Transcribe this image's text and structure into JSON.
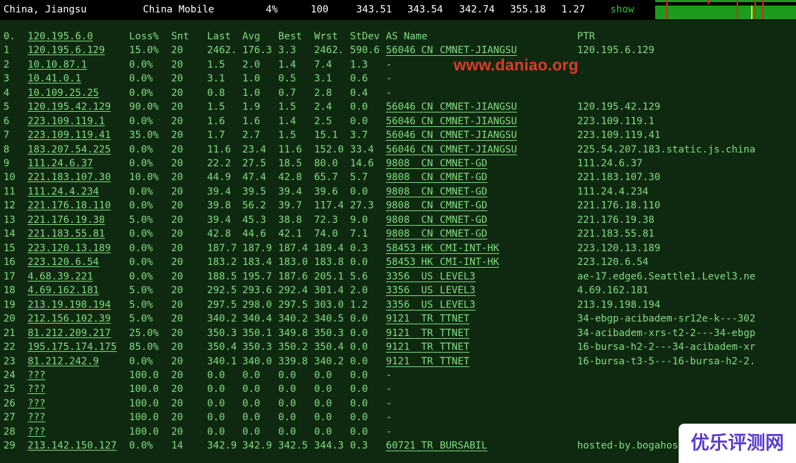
{
  "summary": {
    "location": "China, Jiangsu",
    "isp": "China Mobile",
    "loss": "4%",
    "sent": "100",
    "last": "343.51",
    "avg": "343.54",
    "best": "342.74",
    "worst": "355.18",
    "stdev": "1.27",
    "show_label": "show"
  },
  "header": {
    "hop": "0.",
    "host": "120.195.6.0",
    "loss": "Loss%",
    "sent": "Snt",
    "last": "Last",
    "avg": "Avg",
    "best": "Best",
    "worst": "Wrst",
    "stdev": "StDev",
    "as_name": "AS Name",
    "ptr": "PTR"
  },
  "hops": [
    {
      "hop": "1",
      "host": "120.195.6.129",
      "loss": "15.0%",
      "sent": "20",
      "last": "2462.",
      "avg": "176.3",
      "best": "3.3",
      "worst": "2462.",
      "stdev": "590.6",
      "asn": "56046",
      "cc": "CN",
      "as_name": "CMNET-JIANGSU",
      "ptr": "120.195.6.129"
    },
    {
      "hop": "2",
      "host": "10.10.87.1",
      "loss": "0.0%",
      "sent": "20",
      "last": "1.5",
      "avg": "2.0",
      "best": "1.4",
      "worst": "7.4",
      "stdev": "1.3",
      "asn": "-",
      "cc": "",
      "as_name": "",
      "ptr": ""
    },
    {
      "hop": "3",
      "host": "10.41.0.1",
      "loss": "0.0%",
      "sent": "20",
      "last": "3.1",
      "avg": "1.0",
      "best": "0.5",
      "worst": "3.1",
      "stdev": "0.6",
      "asn": "-",
      "cc": "",
      "as_name": "",
      "ptr": ""
    },
    {
      "hop": "4",
      "host": "10.109.25.25",
      "loss": "0.0%",
      "sent": "20",
      "last": "0.8",
      "avg": "1.0",
      "best": "0.7",
      "worst": "2.8",
      "stdev": "0.4",
      "asn": "-",
      "cc": "",
      "as_name": "",
      "ptr": ""
    },
    {
      "hop": "5",
      "host": "120.195.42.129",
      "loss": "90.0%",
      "sent": "20",
      "last": "1.5",
      "avg": "1.9",
      "best": "1.5",
      "worst": "2.4",
      "stdev": "0.0",
      "asn": "56046",
      "cc": "CN",
      "as_name": "CMNET-JIANGSU",
      "ptr": "120.195.42.129"
    },
    {
      "hop": "6",
      "host": "223.109.119.1",
      "loss": "0.0%",
      "sent": "20",
      "last": "1.6",
      "avg": "1.6",
      "best": "1.4",
      "worst": "2.5",
      "stdev": "0.0",
      "asn": "56046",
      "cc": "CN",
      "as_name": "CMNET-JIANGSU",
      "ptr": "223.109.119.1"
    },
    {
      "hop": "7",
      "host": "223.109.119.41",
      "loss": "35.0%",
      "sent": "20",
      "last": "1.7",
      "avg": "2.7",
      "best": "1.5",
      "worst": "15.1",
      "stdev": "3.7",
      "asn": "56046",
      "cc": "CN",
      "as_name": "CMNET-JIANGSU",
      "ptr": "223.109.119.41"
    },
    {
      "hop": "8",
      "host": "183.207.54.225",
      "loss": "0.0%",
      "sent": "20",
      "last": "11.6",
      "avg": "23.4",
      "best": "11.6",
      "worst": "152.0",
      "stdev": "33.4",
      "asn": "56046",
      "cc": "CN",
      "as_name": "CMNET-JIANGSU",
      "ptr": "225.54.207.183.static.js.china"
    },
    {
      "hop": "9",
      "host": "111.24.6.37",
      "loss": "0.0%",
      "sent": "20",
      "last": "22.2",
      "avg": "27.5",
      "best": "18.5",
      "worst": "80.0",
      "stdev": "14.6",
      "asn": "9808",
      "cc": "CN",
      "as_name": "CMNET-GD",
      "ptr": "111.24.6.37"
    },
    {
      "hop": "10",
      "host": "221.183.107.30",
      "loss": "10.0%",
      "sent": "20",
      "last": "44.9",
      "avg": "47.4",
      "best": "42.8",
      "worst": "65.7",
      "stdev": "5.7",
      "asn": "9808",
      "cc": "CN",
      "as_name": "CMNET-GD",
      "ptr": "221.183.107.30"
    },
    {
      "hop": "11",
      "host": "111.24.4.234",
      "loss": "0.0%",
      "sent": "20",
      "last": "39.4",
      "avg": "39.5",
      "best": "39.4",
      "worst": "39.6",
      "stdev": "0.0",
      "asn": "9808",
      "cc": "CN",
      "as_name": "CMNET-GD",
      "ptr": "111.24.4.234"
    },
    {
      "hop": "12",
      "host": "221.176.18.110",
      "loss": "0.0%",
      "sent": "20",
      "last": "39.8",
      "avg": "56.2",
      "best": "39.7",
      "worst": "117.4",
      "stdev": "27.3",
      "asn": "9808",
      "cc": "CN",
      "as_name": "CMNET-GD",
      "ptr": "221.176.18.110"
    },
    {
      "hop": "13",
      "host": "221.176.19.38",
      "loss": "5.0%",
      "sent": "20",
      "last": "39.4",
      "avg": "45.3",
      "best": "38.8",
      "worst": "72.3",
      "stdev": "9.0",
      "asn": "9808",
      "cc": "CN",
      "as_name": "CMNET-GD",
      "ptr": "221.176.19.38"
    },
    {
      "hop": "14",
      "host": "221.183.55.81",
      "loss": "0.0%",
      "sent": "20",
      "last": "42.8",
      "avg": "44.6",
      "best": "42.1",
      "worst": "74.0",
      "stdev": "7.1",
      "asn": "9808",
      "cc": "CN",
      "as_name": "CMNET-GD",
      "ptr": "221.183.55.81"
    },
    {
      "hop": "15",
      "host": "223.120.13.189",
      "loss": "0.0%",
      "sent": "20",
      "last": "187.7",
      "avg": "187.9",
      "best": "187.4",
      "worst": "189.4",
      "stdev": "0.3",
      "asn": "58453",
      "cc": "HK",
      "as_name": "CMI-INT-HK",
      "ptr": "223.120.13.189"
    },
    {
      "hop": "16",
      "host": "223.120.6.54",
      "loss": "0.0%",
      "sent": "20",
      "last": "183.2",
      "avg": "183.4",
      "best": "183.0",
      "worst": "183.8",
      "stdev": "0.0",
      "asn": "58453",
      "cc": "HK",
      "as_name": "CMI-INT-HK",
      "ptr": "223.120.6.54"
    },
    {
      "hop": "17",
      "host": "4.68.39.221",
      "loss": "0.0%",
      "sent": "20",
      "last": "188.5",
      "avg": "195.7",
      "best": "187.6",
      "worst": "205.1",
      "stdev": "5.6",
      "asn": "3356",
      "cc": "US",
      "as_name": "LEVEL3",
      "ptr": "ae-17.edge6.Seattle1.Level3.ne"
    },
    {
      "hop": "18",
      "host": "4.69.162.181",
      "loss": "5.0%",
      "sent": "20",
      "last": "292.5",
      "avg": "293.6",
      "best": "292.4",
      "worst": "301.4",
      "stdev": "2.0",
      "asn": "3356",
      "cc": "US",
      "as_name": "LEVEL3",
      "ptr": "4.69.162.181"
    },
    {
      "hop": "19",
      "host": "213.19.198.194",
      "loss": "5.0%",
      "sent": "20",
      "last": "297.5",
      "avg": "298.0",
      "best": "297.5",
      "worst": "303.0",
      "stdev": "1.2",
      "asn": "3356",
      "cc": "US",
      "as_name": "LEVEL3",
      "ptr": "213.19.198.194"
    },
    {
      "hop": "20",
      "host": "212.156.102.39",
      "loss": "5.0%",
      "sent": "20",
      "last": "340.2",
      "avg": "340.4",
      "best": "340.2",
      "worst": "340.5",
      "stdev": "0.0",
      "asn": "9121",
      "cc": "TR",
      "as_name": "TTNET",
      "ptr": "34-ebgp-acibadem-sr12e-k---302"
    },
    {
      "hop": "21",
      "host": "81.212.209.217",
      "loss": "25.0%",
      "sent": "20",
      "last": "350.3",
      "avg": "350.1",
      "best": "349.8",
      "worst": "350.3",
      "stdev": "0.0",
      "asn": "9121",
      "cc": "TR",
      "as_name": "TTNET",
      "ptr": "34-acibadem-xrs-t2-2---34-ebgp"
    },
    {
      "hop": "22",
      "host": "195.175.174.175",
      "loss": "85.0%",
      "sent": "20",
      "last": "350.4",
      "avg": "350.3",
      "best": "350.2",
      "worst": "350.4",
      "stdev": "0.0",
      "asn": "9121",
      "cc": "TR",
      "as_name": "TTNET",
      "ptr": "16-bursa-h2-2---34-acibadem-xr"
    },
    {
      "hop": "23",
      "host": "81.212.242.9",
      "loss": "0.0%",
      "sent": "20",
      "last": "340.1",
      "avg": "340.0",
      "best": "339.8",
      "worst": "340.2",
      "stdev": "0.0",
      "asn": "9121",
      "cc": "TR",
      "as_name": "TTNET",
      "ptr": "16-bursa-t3-5---16-bursa-h2-2."
    },
    {
      "hop": "24",
      "host": "???",
      "loss": "100.0",
      "sent": "20",
      "last": "0.0",
      "avg": "0.0",
      "best": "0.0",
      "worst": "0.0",
      "stdev": "0.0",
      "asn": "-",
      "cc": "",
      "as_name": "",
      "ptr": ""
    },
    {
      "hop": "25",
      "host": "???",
      "loss": "100.0",
      "sent": "20",
      "last": "0.0",
      "avg": "0.0",
      "best": "0.0",
      "worst": "0.0",
      "stdev": "0.0",
      "asn": "-",
      "cc": "",
      "as_name": "",
      "ptr": ""
    },
    {
      "hop": "26",
      "host": "???",
      "loss": "100.0",
      "sent": "20",
      "last": "0.0",
      "avg": "0.0",
      "best": "0.0",
      "worst": "0.0",
      "stdev": "0.0",
      "asn": "-",
      "cc": "",
      "as_name": "",
      "ptr": ""
    },
    {
      "hop": "27",
      "host": "???",
      "loss": "100.0",
      "sent": "20",
      "last": "0.0",
      "avg": "0.0",
      "best": "0.0",
      "worst": "0.0",
      "stdev": "0.0",
      "asn": "-",
      "cc": "",
      "as_name": "",
      "ptr": ""
    },
    {
      "hop": "28",
      "host": "???",
      "loss": "100.0",
      "sent": "20",
      "last": "0.0",
      "avg": "0.0",
      "best": "0.0",
      "worst": "0.0",
      "stdev": "0.0",
      "asn": "-",
      "cc": "",
      "as_name": "",
      "ptr": ""
    },
    {
      "hop": "29",
      "host": "213.142.150.127",
      "loss": "0.0%",
      "sent": "14",
      "last": "342.9",
      "avg": "342.9",
      "best": "342.5",
      "worst": "344.3",
      "stdev": "0.3",
      "asn": "60721",
      "cc": "TR",
      "as_name": "BURSABIL",
      "ptr": "hosted-by.bogahos"
    }
  ],
  "watermark": "www.daniao.org",
  "logo_text": "优乐评测网",
  "colors": {
    "background": "#0f2910",
    "text": "#82dc82",
    "summary_bg": "#000000",
    "summary_text": "#ffffff",
    "show_link": "#2fc42f",
    "graph_ok": "#1c9c1c",
    "graph_loss": "#e02424",
    "graph_warn": "#e6e62a",
    "watermark": "#e0392b",
    "logo_text": "#5b3ccf",
    "logo_bg": "#ffffff"
  }
}
